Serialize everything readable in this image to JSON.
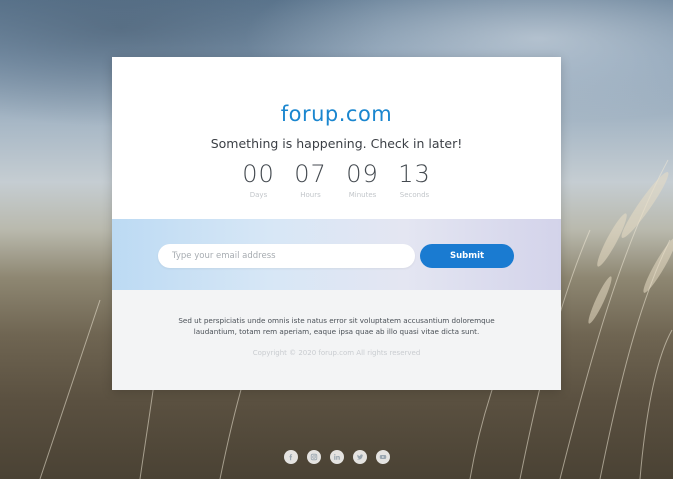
{
  "site": {
    "brand": "forup.com",
    "tagline": "Something is happening. Check in later!"
  },
  "countdown": [
    {
      "value": "00",
      "label": "Days"
    },
    {
      "value": "07",
      "label": "Hours"
    },
    {
      "value": "09",
      "label": "Minutes"
    },
    {
      "value": "13",
      "label": "Seconds"
    }
  ],
  "subscribe": {
    "placeholder": "Type your email address",
    "button_label": "Submit"
  },
  "footer": {
    "description": "Sed ut perspiciatis unde omnis iste natus error sit voluptatem accusantium doloremque laudantium, totam rem aperiam, eaque ipsa quae ab illo quasi vitae dicta sunt.",
    "copyright": "Copyright © 2020 forup.com All rights reserved"
  },
  "social": [
    "facebook-icon",
    "instagram-icon",
    "linkedin-icon",
    "twitter-icon",
    "youtube-icon"
  ],
  "colors": {
    "accent": "#1a86cf",
    "button": "#1a7bd1"
  }
}
